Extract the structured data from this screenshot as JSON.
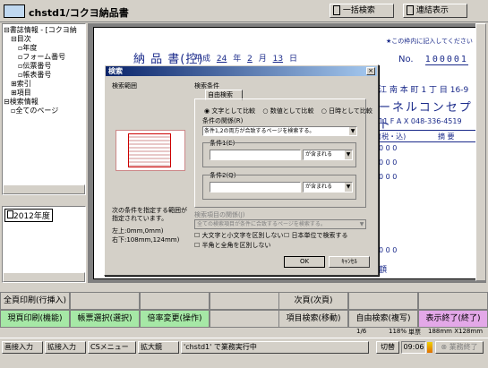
{
  "titlebar": {
    "title": "chstd1/コクヨ納品書",
    "btn_search": "一括検索",
    "btn_link": "連結表示"
  },
  "tree": {
    "items": [
      {
        "label": "書誌情報 - [コクヨ納",
        "indent": 0,
        "sign": "-"
      },
      {
        "label": "目次",
        "indent": 1,
        "sign": "-"
      },
      {
        "label": "年度",
        "indent": 2,
        "sign": ""
      },
      {
        "label": "フォーム番号",
        "indent": 2,
        "sign": ""
      },
      {
        "label": "伝票番号",
        "indent": 2,
        "sign": ""
      },
      {
        "label": "帳表番号",
        "indent": 2,
        "sign": ""
      },
      {
        "label": "索引",
        "indent": 1,
        "sign": "+"
      },
      {
        "label": "項目",
        "indent": 1,
        "sign": "+"
      },
      {
        "label": "検索情報",
        "indent": 0,
        "sign": "-"
      },
      {
        "label": "全てのページ",
        "indent": 1,
        "sign": ""
      }
    ],
    "list_item": "2012年度"
  },
  "document": {
    "title": "納 品 書(控)",
    "date_era": "平成",
    "date_year": "24",
    "date_year_unit": "年",
    "date_month": "2",
    "date_month_unit": "月",
    "date_day": "13",
    "date_day_unit": "日",
    "note": "★この枠内に記入してください",
    "no_label": "No.",
    "no_value": "100001",
    "address": "江 南 本 町 1 丁 目 16-9",
    "company": "ーネルコンセプト",
    "fax": "11 F A X 048-336-4519",
    "col_tax": "(税・込)",
    "col_remarks": "摘 要",
    "row_val": "0 0 0",
    "footer_total_label": "額"
  },
  "dialog": {
    "title": "検索",
    "close": "×",
    "range_label": "検索範囲",
    "cond_label": "検索条件",
    "tab": "自由検索",
    "radio_text": "文字として比較",
    "radio_num": "数値として比較",
    "radio_date": "日時として比較",
    "relation_label": "条件の関係(R)",
    "relation_value": "条件1,2の両方が合致するページを検索する。",
    "cond1_label": "条件1(E)",
    "cond1_op": "が含まれる",
    "cond2_label": "条件2(Q)",
    "cond2_op": "が含まれる",
    "hint": "次の条件を指定する範囲が指定されています。",
    "topleft": "左上:0mm,0mm)",
    "bottomright": "右下:108mm,124mm)",
    "item_label": "検索項目の関係(J)",
    "item_value": "全ての検索項目が条件に合致するページを検索する。",
    "check1": "大文字と小文字を区別しない",
    "check2": "日本単位で検索する",
    "check3": "半角と全角を区別しない",
    "ok": "OK",
    "cancel": "ｷｬﾝｾﾙ"
  },
  "funcbar": {
    "row1": [
      "全頁印刷(行挿入)",
      "",
      "",
      "",
      "次頁(次頁)",
      "",
      ""
    ],
    "row2": [
      "現頁印刷(機能)",
      "帳票選択(選択)",
      "倍率変更(操作)",
      "",
      "項目検索(移動)",
      "自由検索(複写)",
      "表示終了(終了)"
    ],
    "colors": {
      "green": "#a6e8a6",
      "purple": "#e3a8e8",
      "gray": "#d4d0c8"
    }
  },
  "statusbar": {
    "page": "1/6",
    "zoom": "118%",
    "unit": "単票",
    "size": "188mm X128mm"
  },
  "taskbar": {
    "items": [
      "画接入力",
      "拡接入力",
      "CSメニュー",
      "拡大鏡",
      "'chstd1' で業務実行中"
    ],
    "switch": "切替",
    "time": "09:06",
    "end": "業務終了"
  }
}
